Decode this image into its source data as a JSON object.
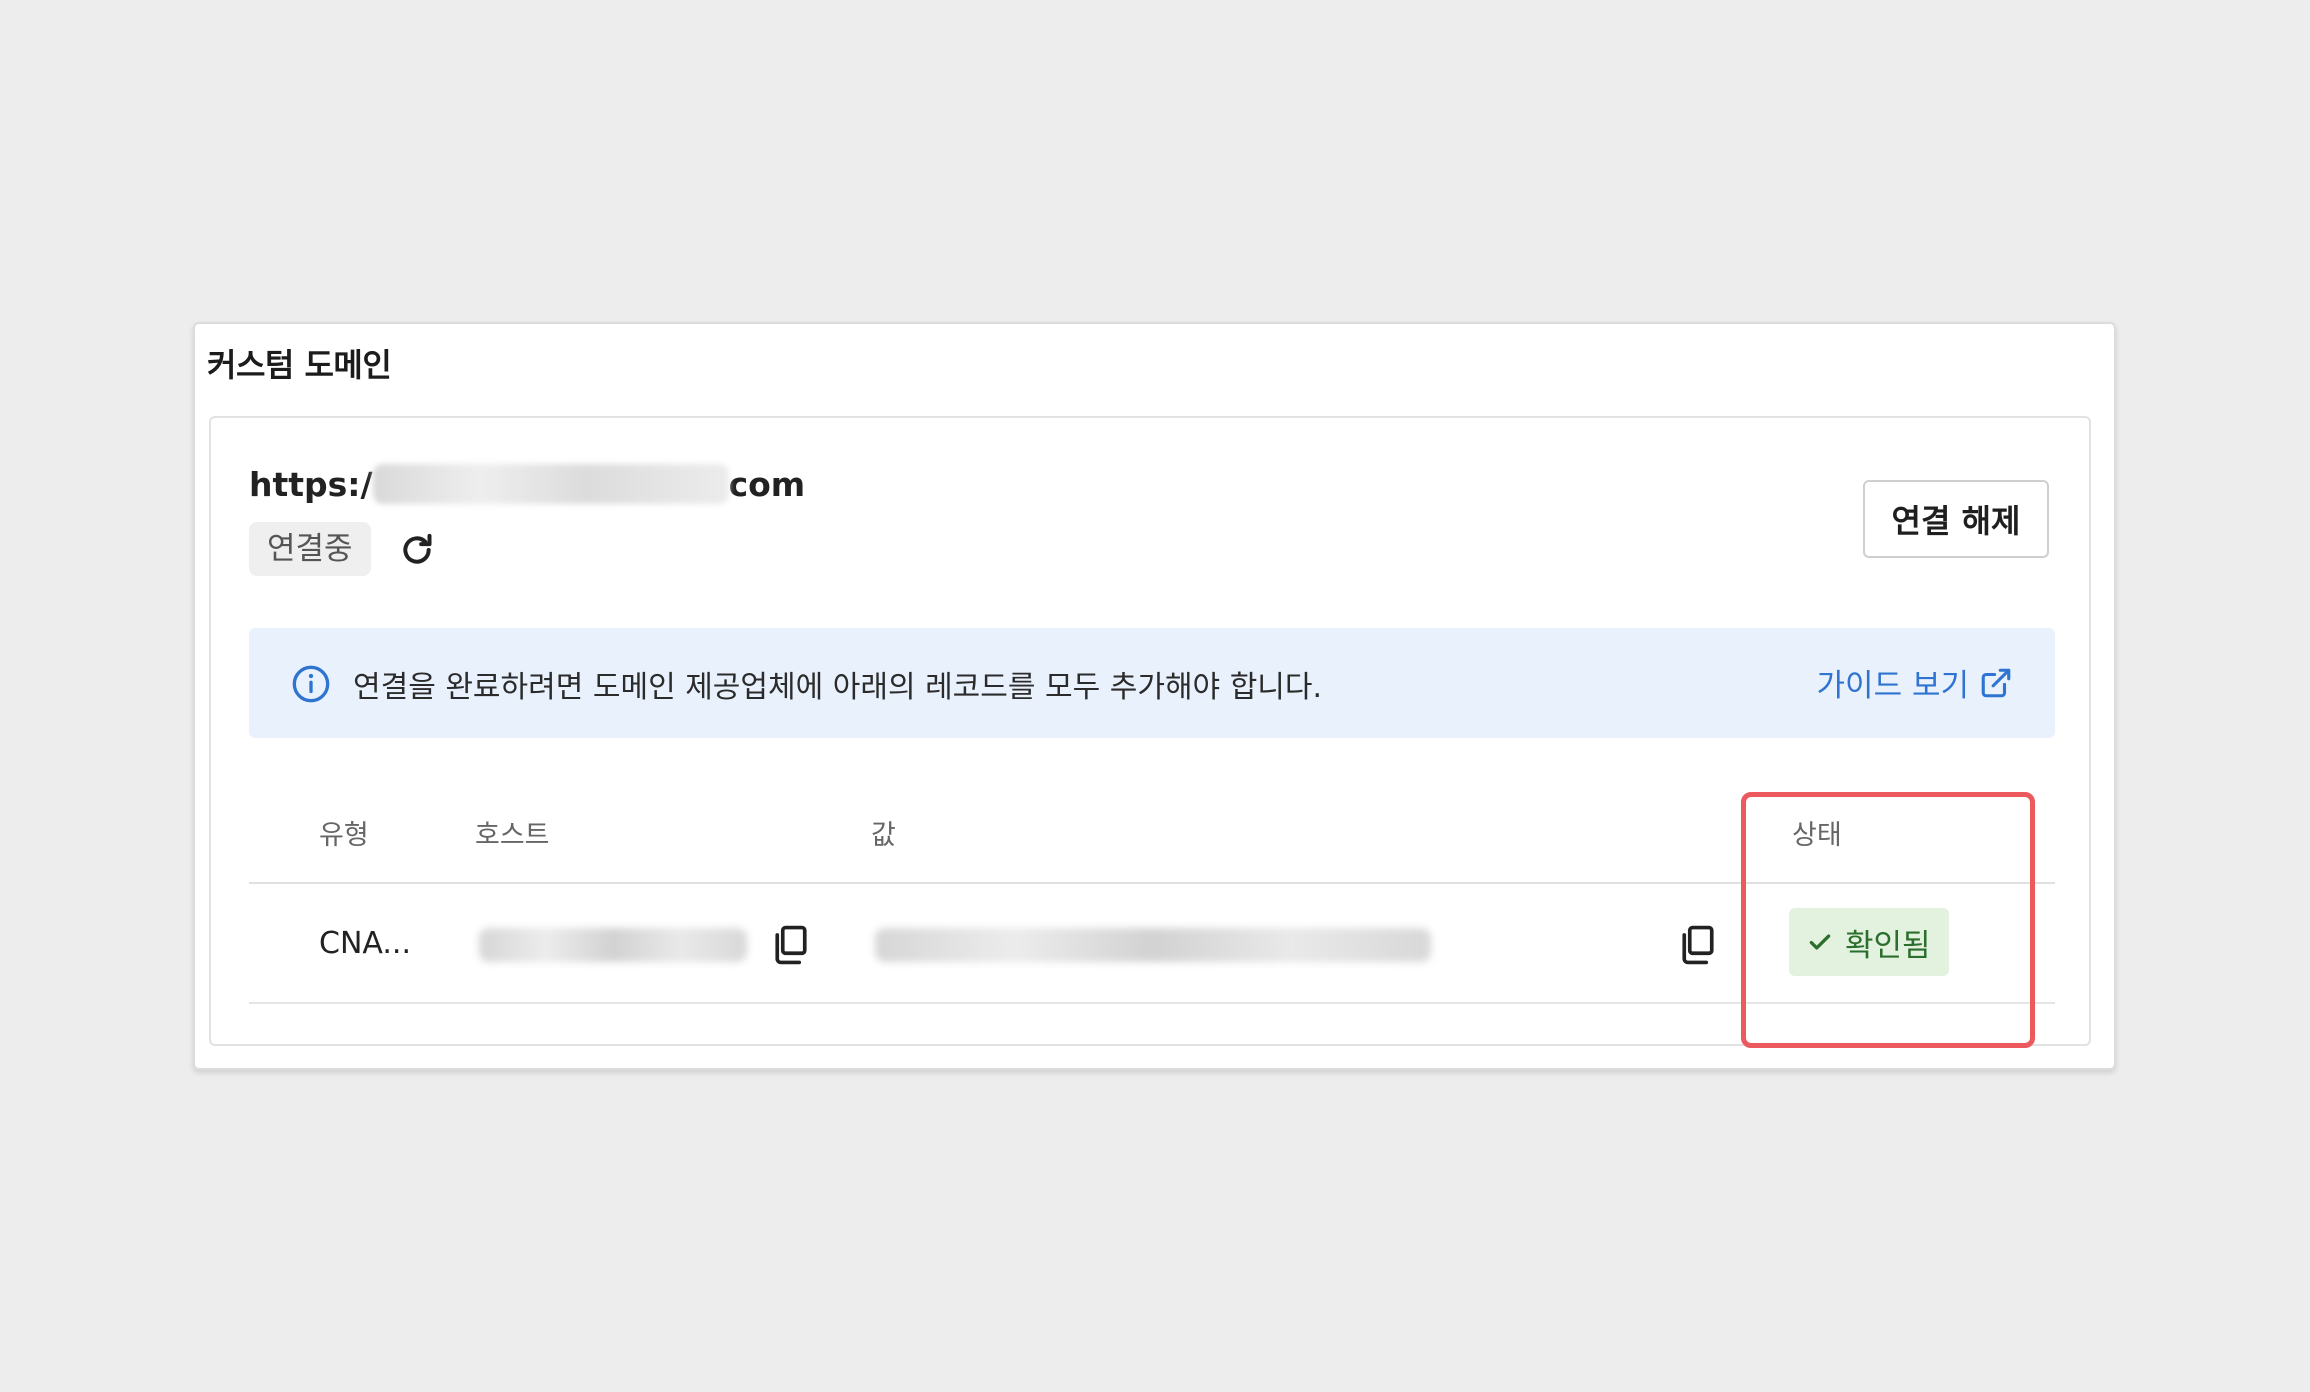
{
  "card": {
    "title": "커스텀 도메인"
  },
  "domain": {
    "url_prefix": "https:/",
    "url_suffix": "com",
    "status_label": "연결중",
    "disconnect_label": "연결 해제"
  },
  "info": {
    "message": "연결을 완료하려면 도메인 제공업체에 아래의 레코드를 모두 추가해야 합니다.",
    "guide_label": "가이드 보기"
  },
  "table": {
    "headers": {
      "type": "유형",
      "host": "호스트",
      "value": "값",
      "status": "상태"
    },
    "rows": [
      {
        "type": "CNA...",
        "status": "확인됨"
      }
    ]
  },
  "colors": {
    "accent_link": "#2f74d0",
    "verified_bg": "#e2f2df",
    "verified_text": "#2c6e2e",
    "highlight": "#ec5a5e"
  }
}
